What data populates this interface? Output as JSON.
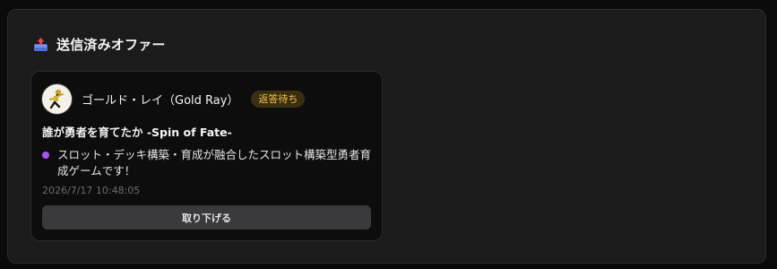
{
  "section": {
    "icon": "outbox-tray-icon",
    "title": "送信済みオファー"
  },
  "offer": {
    "avatar_icon": "character-avatar-icon",
    "user_name": "ゴールド・レイ（Gold Ray）",
    "status": "返答待ち",
    "game_title": "誰が勇者を育てたか -Spin of Fate-",
    "description": "スロット・デッキ構築・育成が融合したスロット構築型勇者育成ゲームです！",
    "timestamp": "2026/7/17 10:48:05",
    "withdraw_label": "取り下げる"
  },
  "colors": {
    "background": "#0a0a0a",
    "panel": "#1b1b1c",
    "card": "#0d0d0e",
    "status_text": "#f2c14e",
    "status_bg": "#3a2f10",
    "bullet": "#a855f7",
    "button": "#3a3a3d"
  }
}
